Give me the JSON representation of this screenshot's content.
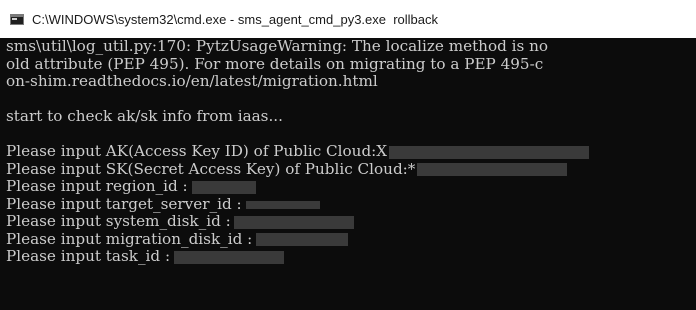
{
  "window": {
    "title": "C:\\WINDOWS\\system32\\cmd.exe - sms_agent_cmd_py3.exe  rollback",
    "icon": "cmd-icon"
  },
  "console": {
    "lines": [
      "sms\\util\\log_util.py:170: PytzUsageWarning: The localize method is no",
      "old attribute (PEP 495). For more details on migrating to a PEP 495-c",
      "on-shim.readthedocs.io/en/latest/migration.html",
      "",
      "start to check ak/sk info from iaas...",
      "",
      "Please input AK(Access Key ID) of Public Cloud:X",
      "Please input SK(Secret Access Key) of Public Cloud:*",
      "Please input region_id :",
      "Please input target_server_id :",
      "Please input system_disk_id :",
      "Please input migration_disk_id :",
      "Please input task_id :"
    ]
  },
  "colors": {
    "console_bg": "#0c0c0c",
    "console_fg": "#cccccc",
    "redaction": "#3a3a3a",
    "titlebar_bg": "#ffffff"
  }
}
